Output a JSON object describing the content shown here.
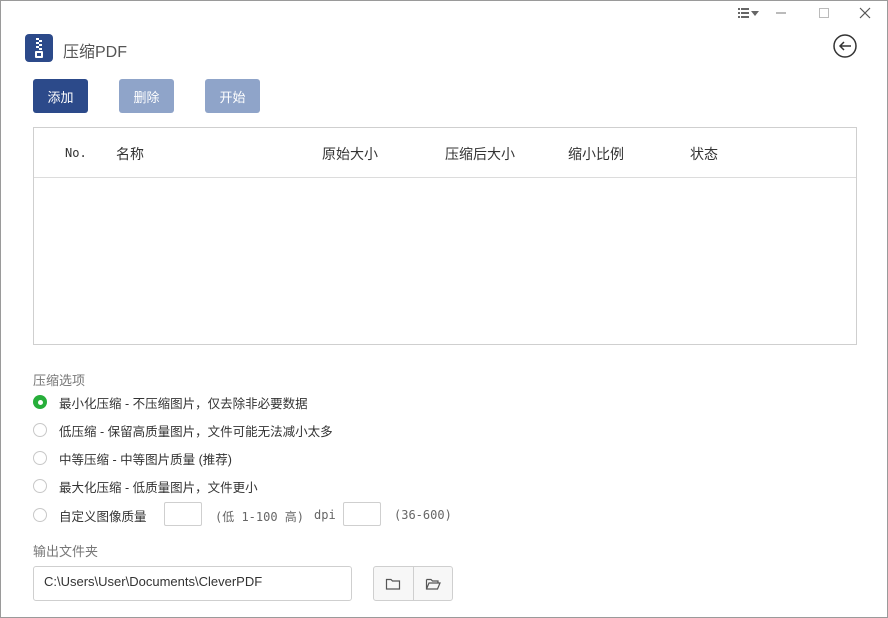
{
  "app": {
    "title": "压缩PDF"
  },
  "toolbar": {
    "add_label": "添加",
    "delete_label": "删除",
    "start_label": "开始"
  },
  "table": {
    "headers": [
      "No.",
      "名称",
      "原始大小",
      "压缩后大小",
      "缩小比例",
      "状态"
    ],
    "rows": []
  },
  "options": {
    "section_label": "压缩选项",
    "selected_index": 0,
    "items": [
      "最小化压缩 - 不压缩图片，仅去除非必要数据",
      "低压缩 - 保留高质量图片，文件可能无法减小太多",
      "中等压缩 - 中等图片质量 (推荐)",
      "最大化压缩 - 低质量图片，文件更小",
      "自定义图像质量"
    ],
    "quality_value": "",
    "quality_hint": "(低 1-100 高)",
    "dpi_label": "dpi",
    "dpi_value": "",
    "dpi_hint": "(36-600)"
  },
  "output": {
    "section_label": "输出文件夹",
    "path": "C:\\Users\\User\\Documents\\CleverPDF"
  },
  "colors": {
    "accent": "#2c4a8a",
    "disabled": "#8fa4c9",
    "radio_on": "#27ae3a"
  }
}
